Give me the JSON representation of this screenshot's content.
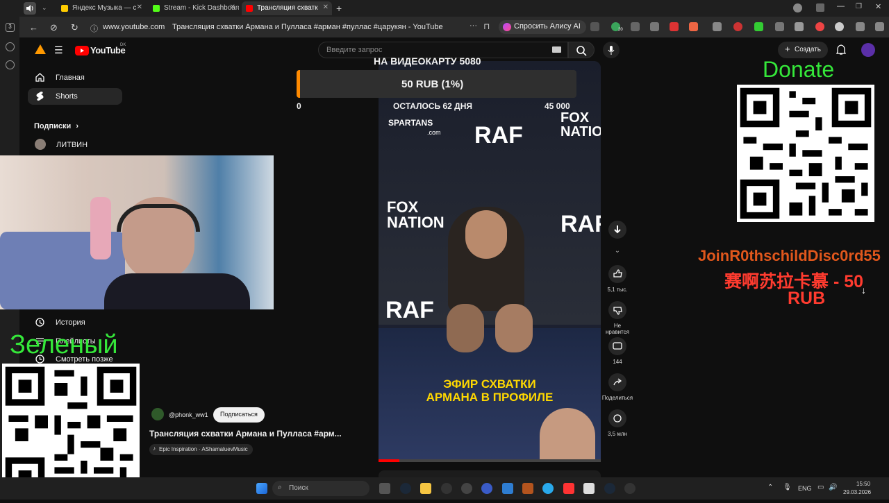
{
  "browser": {
    "tabs": [
      {
        "label": "Яндекс Музыка — с",
        "icon": "yandex-music-icon",
        "color": "#ffcc00"
      },
      {
        "label": "Stream - Kick Dashboard",
        "icon": "kick-icon",
        "color": "#53fc18"
      },
      {
        "label": "Трансляция схватк",
        "icon": "youtube-icon",
        "color": "#ff0000"
      }
    ],
    "tab_count_badge": "3",
    "url": "www.youtube.com",
    "page_title": "Трансляция схватки Армана и Пулласа #арман #пуллас #царукян - YouTube",
    "more": "···",
    "alisa_button": "Спросить Алису AI",
    "ext_badge": "20"
  },
  "youtube": {
    "logo_text": "YouTube",
    "region": "DK",
    "search_placeholder": "Введите запрос",
    "create_label": "Создать",
    "sidebar": {
      "items": [
        {
          "label": "Главная",
          "icon": "home-icon"
        },
        {
          "label": "Shorts",
          "icon": "shorts-icon"
        }
      ],
      "subscriptions_label": "Подписки",
      "subscription_channel": "ЛИТВИН",
      "lower_items": [
        {
          "label": "История",
          "icon": "history-icon"
        },
        {
          "label": "Плейлисты",
          "icon": "playlists-icon"
        },
        {
          "label": "Смотреть позже",
          "icon": "watch-later-icon"
        }
      ]
    },
    "short": {
      "channel": "@phonk_ww1",
      "subscribe_label": "Подписаться",
      "title": "Трансляция схватки Армана и Пулласа  #арм...",
      "music": "Epic Inspiration · AShamaluevMusic",
      "video_text": {
        "sponsor1": "SPARTANS",
        "sponsor1_sub": ".com",
        "sponsor2": "RAF",
        "sponsor3": "FOX NATION",
        "banner_line1": "ЭФИР СХВАТКИ",
        "banner_line2": "АРМАНА В ПРОФИЛЕ"
      },
      "actions": {
        "likes": "5,1 тыс.",
        "dislike_label": "Не нравится",
        "comments": "144",
        "share_label": "Поделиться",
        "remix": "3,5 млн"
      }
    }
  },
  "overlays": {
    "donate_label": "Donate",
    "goal_title": "НА ВИДЕОКАРТУ 5080",
    "goal_value": "50 RUB (1%)",
    "goal_progress": 0.01,
    "goal_min": "0",
    "goal_remaining": "ОСТАЛОСЬ 62 ДНЯ",
    "goal_max": "45 000",
    "alert_line1": "JoinR0thschildDisc0rd55",
    "alert_line2": "赛啊苏拉卡慕 - 50",
    "alert_line3": "RUB",
    "zeleny_label": "Зеленый"
  },
  "taskbar": {
    "search_placeholder": "Поиск",
    "lang": "ENG",
    "time": "15:50",
    "date": "29.03.2026"
  },
  "colors": {
    "accent": "#ff0000",
    "overlay_green": "#35e83a",
    "goal_orange": "#ff8a00"
  }
}
